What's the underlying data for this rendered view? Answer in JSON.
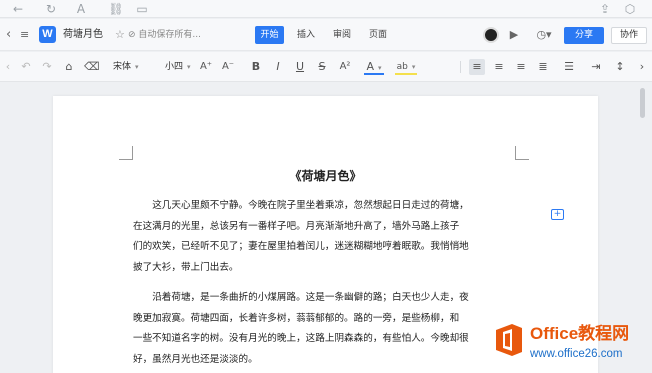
{
  "app": {
    "logo_letter": "W",
    "doc_title": "荷塘月色",
    "save_status": "自动保存所有...",
    "tabs": [
      "开始",
      "插入",
      "审阅",
      "页面"
    ],
    "active_tab": "开始",
    "share_label": "分享",
    "collab_label": "协作",
    "accent_color": "#2b79f3"
  },
  "toolbar": {
    "font_family": "宋体",
    "font_size": "小四",
    "grow_font": "A⁺",
    "shrink_font": "A⁻",
    "bold": "B",
    "italic": "I",
    "underline": "U",
    "strike": "S",
    "font_color": "A",
    "highlight": "ab"
  },
  "document": {
    "heading": "《荷塘月色》",
    "paragraph1": [
      "这几天心里颇不宁静。今晚在院子里坐着乘凉，忽然想起日日走过的荷塘，",
      "在这满月的光里，总该另有一番样子吧。月亮渐渐地升高了，墙外马路上孩子",
      "们的欢笑，已经听不见了；妻在屋里拍着闰儿，迷迷糊糊地哼着眠歌。我悄悄地",
      "披了大衫，带上门出去。"
    ],
    "paragraph2": [
      "沿着荷塘，是一条曲折的小煤屑路。这是一条幽僻的路；白天也少人走，夜",
      "晚更加寂寞。荷塘四面，长着许多树，蓊蓊郁郁的。路的一旁，是些杨柳，和",
      "一些不知道名字的树。没有月光的晚上，这路上阴森森的，有些怕人。今晚却很",
      "好，虽然月光也还是淡淡的。"
    ]
  },
  "watermark": {
    "name": "Office教程网",
    "url": "www.office26.com",
    "brand_color": "#e8580d"
  }
}
